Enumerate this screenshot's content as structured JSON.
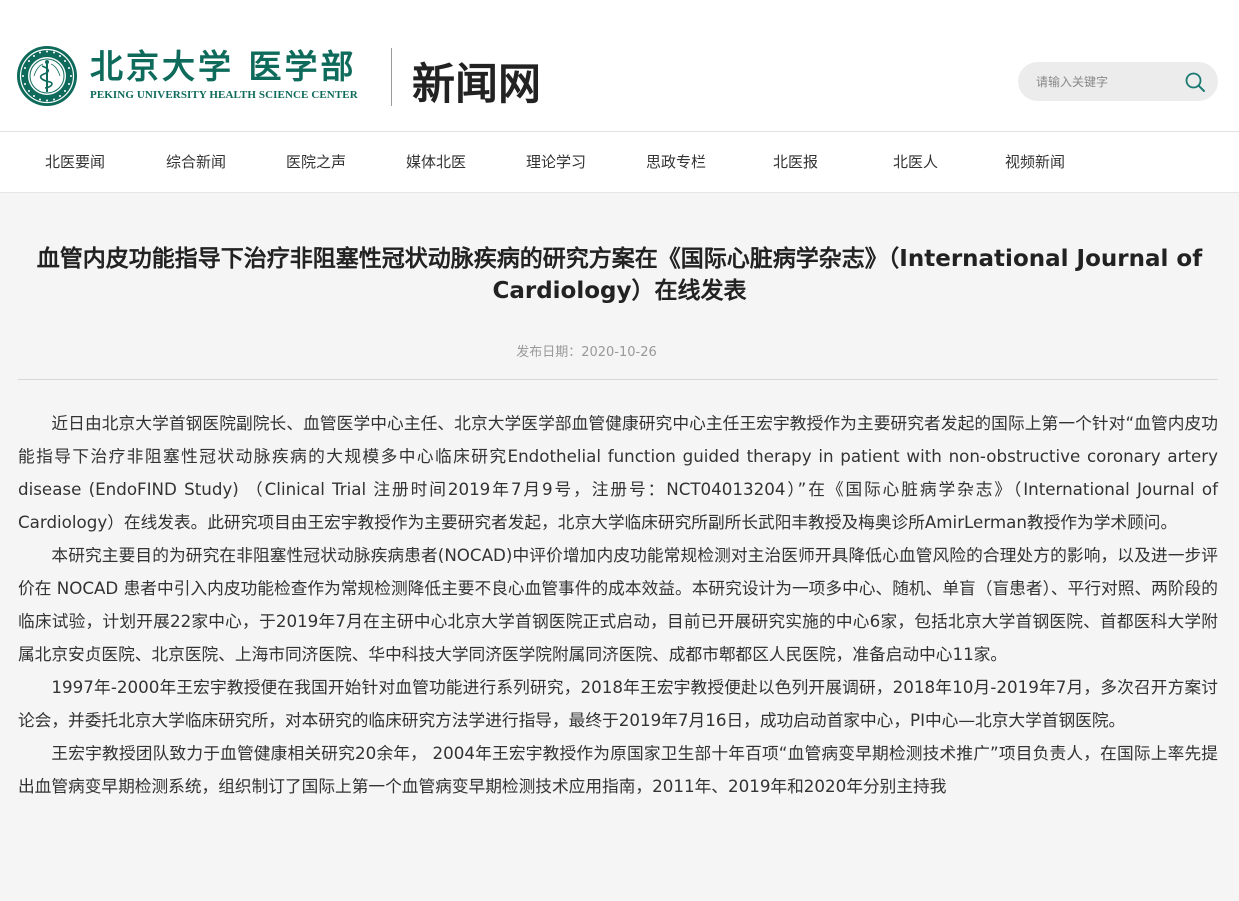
{
  "header": {
    "logo_cn": "北京大学 医学部",
    "logo_en": "PEKING UNIVERSITY HEALTH SCIENCE CENTER",
    "site_name": "新闻网",
    "search_placeholder": "请输入关键字"
  },
  "nav": [
    {
      "label": "北医要闻"
    },
    {
      "label": "综合新闻"
    },
    {
      "label": "医院之声"
    },
    {
      "label": "媒体北医"
    },
    {
      "label": "理论学习"
    },
    {
      "label": "思政专栏"
    },
    {
      "label": "北医报"
    },
    {
      "label": "北医人"
    },
    {
      "label": "视频新闻"
    }
  ],
  "article": {
    "title": "血管内皮功能指导下治疗非阻塞性冠状动脉疾病的研究方案在《国际心脏病学杂志》（International Journal of Cardiology）在线发表",
    "pubdate": "发布日期：2020-10-26",
    "paragraphs": [
      "近日由北京大学首钢医院副院长、血管医学中心主任、北京大学医学部血管健康研究中心主任王宏宇教授作为主要研究者发起的国际上第一个针对“血管内皮功能指导下治疗非阻塞性冠状动脉疾病的大规模多中心临床研究Endothelial function guided therapy in patient with non-obstructive coronary artery disease (EndoFIND Study) （Clinical Trial 注册时间2019年7月9号，注册号：NCT04013204）”在《国际心脏病学杂志》（International Journal of Cardiology）在线发表。此研究项目由王宏宇教授作为主要研究者发起，北京大学临床研究所副所长武阳丰教授及梅奥诊所AmirLerman教授作为学术顾问。",
      "本研究主要目的为研究在非阻塞性冠状动脉疾病患者(NOCAD)中评价增加内皮功能常规检测对主治医师开具降低心血管风险的合理处方的影响，以及进一步评价在 NOCAD 患者中引入内皮功能检查作为常规检测降低主要不良心血管事件的成本效益。本研究设计为一项多中心、随机、单盲（盲患者）、平行对照、两阶段的临床试验，计划开展22家中心，于2019年7月在主研中心北京大学首钢医院正式启动，目前已开展研究实施的中心6家，包括北京大学首钢医院、首都医科大学附属北京安贞医院、北京医院、上海市同济医院、华中科技大学同济医学院附属同济医院、成都市郫都区人民医院，准备启动中心11家。",
      "1997年-2000年王宏宇教授便在我国开始针对血管功能进行系列研究，2018年王宏宇教授便赴以色列开展调研，2018年10月-2019年7月，多次召开方案讨论会，并委托北京大学临床研究所，对本研究的临床研究方法学进行指导，最终于2019年7月16日，成功启动首家中心，PI中心—北京大学首钢医院。",
      "王宏宇教授团队致力于血管健康相关研究20余年， 2004年王宏宇教授作为原国家卫生部十年百项“血管病变早期检测技术推广”项目负责人，在国际上率先提出血管病变早期检测系统，组织制订了国际上第一个血管病变早期检测技术应用指南，2011年、2019年和2020年分别主持我"
    ]
  },
  "colors": {
    "brand_green": "#0e6b5b",
    "search_icon": "#1a7a72"
  }
}
